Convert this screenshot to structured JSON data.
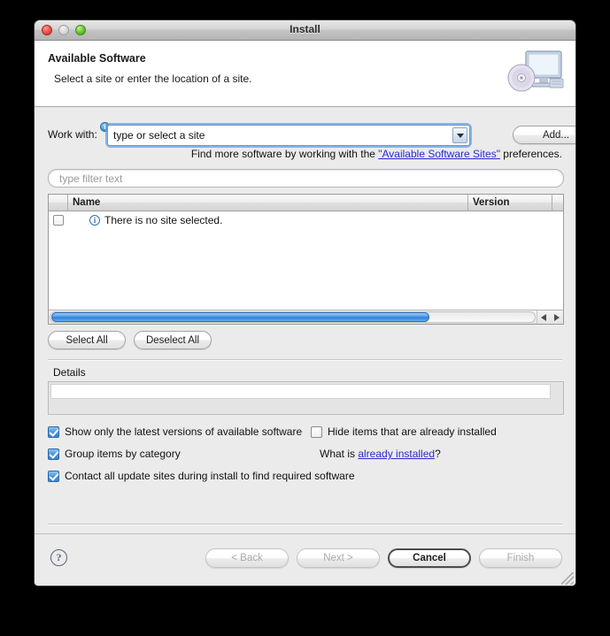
{
  "window": {
    "title": "Install",
    "traffic_lights": [
      "close-button",
      "minimize-button",
      "zoom-button"
    ]
  },
  "header": {
    "title": "Available Software",
    "subtitle": "Select a site or enter the location of a site.",
    "icon": "monitor-with-disc-icon"
  },
  "work_with": {
    "label": "Work with:",
    "info_badge": "i",
    "value": "type or select a site",
    "dropdown_icon": "chevron-down-icon",
    "add_button": "Add..."
  },
  "find_more": {
    "prefix": "Find more software by working with the ",
    "link": "\"Available Software Sites\"",
    "suffix": " preferences."
  },
  "filter": {
    "placeholder": "type filter text",
    "value": ""
  },
  "table": {
    "columns": [
      "",
      "Name",
      "Version",
      ""
    ],
    "rows": [
      {
        "checked": false,
        "icon": "info-icon",
        "name": "There is no site selected.",
        "version": ""
      }
    ],
    "scrollbar": {
      "left_arrow": "arrow-left-icon",
      "right_arrow": "arrow-right-icon"
    }
  },
  "selection_buttons": {
    "select_all": "Select All",
    "deselect_all": "Deselect All"
  },
  "details": {
    "label": "Details",
    "text": ""
  },
  "options": [
    {
      "label": "Show only the latest versions of available software",
      "checked": true
    },
    {
      "label": "Group items by category",
      "checked": true
    },
    {
      "label": "Contact all update sites during install to find required software",
      "checked": true
    },
    {
      "label": "Hide items that are already installed",
      "checked": false
    }
  ],
  "what_is": {
    "prefix": "What is ",
    "link": "already installed",
    "suffix": "?"
  },
  "footer": {
    "help": "?",
    "back": "< Back",
    "next": "Next >",
    "cancel": "Cancel",
    "finish": "Finish"
  },
  "colors": {
    "link": "#2a2ad0",
    "accent_blue": "#4d95dd",
    "window_bg": "#ebebeb",
    "header_bg": "#ffffff"
  }
}
